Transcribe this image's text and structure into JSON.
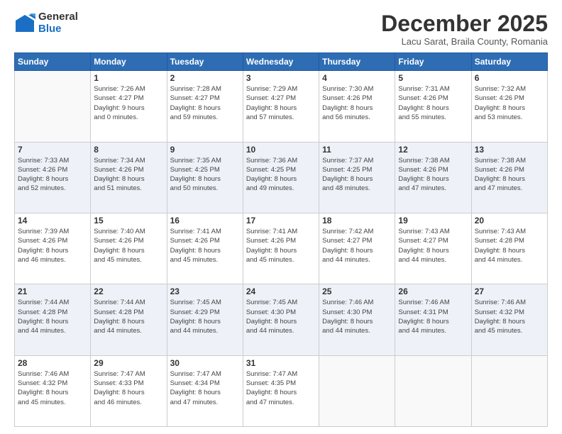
{
  "header": {
    "logo_general": "General",
    "logo_blue": "Blue",
    "month_title": "December 2025",
    "location": "Lacu Sarat, Braila County, Romania"
  },
  "days_of_week": [
    "Sunday",
    "Monday",
    "Tuesday",
    "Wednesday",
    "Thursday",
    "Friday",
    "Saturday"
  ],
  "weeks": [
    [
      {
        "day": "",
        "info": ""
      },
      {
        "day": "1",
        "info": "Sunrise: 7:26 AM\nSunset: 4:27 PM\nDaylight: 9 hours\nand 0 minutes."
      },
      {
        "day": "2",
        "info": "Sunrise: 7:28 AM\nSunset: 4:27 PM\nDaylight: 8 hours\nand 59 minutes."
      },
      {
        "day": "3",
        "info": "Sunrise: 7:29 AM\nSunset: 4:27 PM\nDaylight: 8 hours\nand 57 minutes."
      },
      {
        "day": "4",
        "info": "Sunrise: 7:30 AM\nSunset: 4:26 PM\nDaylight: 8 hours\nand 56 minutes."
      },
      {
        "day": "5",
        "info": "Sunrise: 7:31 AM\nSunset: 4:26 PM\nDaylight: 8 hours\nand 55 minutes."
      },
      {
        "day": "6",
        "info": "Sunrise: 7:32 AM\nSunset: 4:26 PM\nDaylight: 8 hours\nand 53 minutes."
      }
    ],
    [
      {
        "day": "7",
        "info": "Sunrise: 7:33 AM\nSunset: 4:26 PM\nDaylight: 8 hours\nand 52 minutes."
      },
      {
        "day": "8",
        "info": "Sunrise: 7:34 AM\nSunset: 4:26 PM\nDaylight: 8 hours\nand 51 minutes."
      },
      {
        "day": "9",
        "info": "Sunrise: 7:35 AM\nSunset: 4:25 PM\nDaylight: 8 hours\nand 50 minutes."
      },
      {
        "day": "10",
        "info": "Sunrise: 7:36 AM\nSunset: 4:25 PM\nDaylight: 8 hours\nand 49 minutes."
      },
      {
        "day": "11",
        "info": "Sunrise: 7:37 AM\nSunset: 4:25 PM\nDaylight: 8 hours\nand 48 minutes."
      },
      {
        "day": "12",
        "info": "Sunrise: 7:38 AM\nSunset: 4:26 PM\nDaylight: 8 hours\nand 47 minutes."
      },
      {
        "day": "13",
        "info": "Sunrise: 7:38 AM\nSunset: 4:26 PM\nDaylight: 8 hours\nand 47 minutes."
      }
    ],
    [
      {
        "day": "14",
        "info": "Sunrise: 7:39 AM\nSunset: 4:26 PM\nDaylight: 8 hours\nand 46 minutes."
      },
      {
        "day": "15",
        "info": "Sunrise: 7:40 AM\nSunset: 4:26 PM\nDaylight: 8 hours\nand 45 minutes."
      },
      {
        "day": "16",
        "info": "Sunrise: 7:41 AM\nSunset: 4:26 PM\nDaylight: 8 hours\nand 45 minutes."
      },
      {
        "day": "17",
        "info": "Sunrise: 7:41 AM\nSunset: 4:26 PM\nDaylight: 8 hours\nand 45 minutes."
      },
      {
        "day": "18",
        "info": "Sunrise: 7:42 AM\nSunset: 4:27 PM\nDaylight: 8 hours\nand 44 minutes."
      },
      {
        "day": "19",
        "info": "Sunrise: 7:43 AM\nSunset: 4:27 PM\nDaylight: 8 hours\nand 44 minutes."
      },
      {
        "day": "20",
        "info": "Sunrise: 7:43 AM\nSunset: 4:28 PM\nDaylight: 8 hours\nand 44 minutes."
      }
    ],
    [
      {
        "day": "21",
        "info": "Sunrise: 7:44 AM\nSunset: 4:28 PM\nDaylight: 8 hours\nand 44 minutes."
      },
      {
        "day": "22",
        "info": "Sunrise: 7:44 AM\nSunset: 4:28 PM\nDaylight: 8 hours\nand 44 minutes."
      },
      {
        "day": "23",
        "info": "Sunrise: 7:45 AM\nSunset: 4:29 PM\nDaylight: 8 hours\nand 44 minutes."
      },
      {
        "day": "24",
        "info": "Sunrise: 7:45 AM\nSunset: 4:30 PM\nDaylight: 8 hours\nand 44 minutes."
      },
      {
        "day": "25",
        "info": "Sunrise: 7:46 AM\nSunset: 4:30 PM\nDaylight: 8 hours\nand 44 minutes."
      },
      {
        "day": "26",
        "info": "Sunrise: 7:46 AM\nSunset: 4:31 PM\nDaylight: 8 hours\nand 44 minutes."
      },
      {
        "day": "27",
        "info": "Sunrise: 7:46 AM\nSunset: 4:32 PM\nDaylight: 8 hours\nand 45 minutes."
      }
    ],
    [
      {
        "day": "28",
        "info": "Sunrise: 7:46 AM\nSunset: 4:32 PM\nDaylight: 8 hours\nand 45 minutes."
      },
      {
        "day": "29",
        "info": "Sunrise: 7:47 AM\nSunset: 4:33 PM\nDaylight: 8 hours\nand 46 minutes."
      },
      {
        "day": "30",
        "info": "Sunrise: 7:47 AM\nSunset: 4:34 PM\nDaylight: 8 hours\nand 47 minutes."
      },
      {
        "day": "31",
        "info": "Sunrise: 7:47 AM\nSunset: 4:35 PM\nDaylight: 8 hours\nand 47 minutes."
      },
      {
        "day": "",
        "info": ""
      },
      {
        "day": "",
        "info": ""
      },
      {
        "day": "",
        "info": ""
      }
    ]
  ]
}
